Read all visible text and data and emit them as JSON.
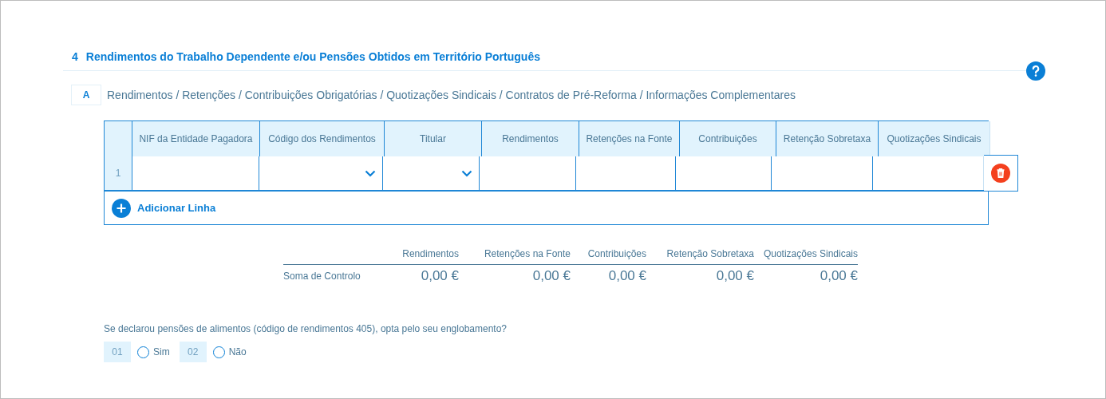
{
  "section": {
    "number": "4",
    "title": "Rendimentos do Trabalho Dependente e/ou Pensões Obtidos em Território Português"
  },
  "subsection": {
    "letter": "A",
    "title": "Rendimentos / Retenções / Contribuições Obrigatórias / Quotizações Sindicais / Contratos de Pré-Reforma / Informações Complementares"
  },
  "table": {
    "columns": [
      {
        "label": "NIF da Entidade Pagadora",
        "kind": "text"
      },
      {
        "label": "Código dos Rendimentos",
        "kind": "select"
      },
      {
        "label": "Titular",
        "kind": "select"
      },
      {
        "label": "Rendimentos",
        "kind": "text"
      },
      {
        "label": "Retenções na Fonte",
        "kind": "text"
      },
      {
        "label": "Contribuições",
        "kind": "text"
      },
      {
        "label": "Retenção Sobretaxa",
        "kind": "text"
      },
      {
        "label": "Quotizações Sindicais",
        "kind": "text"
      }
    ],
    "rows": [
      {
        "number": "1"
      }
    ],
    "add_button": "Adicionar Linha"
  },
  "totals": {
    "label": "Soma de Controlo",
    "columns": [
      {
        "label": "Rendimentos",
        "value": "0,00 €"
      },
      {
        "label": "Retenções na Fonte",
        "value": "0,00 €"
      },
      {
        "label": "Contribuições",
        "value": "0,00 €"
      },
      {
        "label": "Retenção Sobretaxa",
        "value": "0,00 €"
      },
      {
        "label": "Quotizações Sindicais",
        "value": "0,00 €"
      }
    ]
  },
  "question": {
    "text": "Se declarou pensões de alimentos (código de rendimentos 405), opta pelo seu englobamento?",
    "options": [
      {
        "code": "01",
        "label": "Sim",
        "selected": false
      },
      {
        "code": "02",
        "label": "Não",
        "selected": false
      }
    ]
  }
}
